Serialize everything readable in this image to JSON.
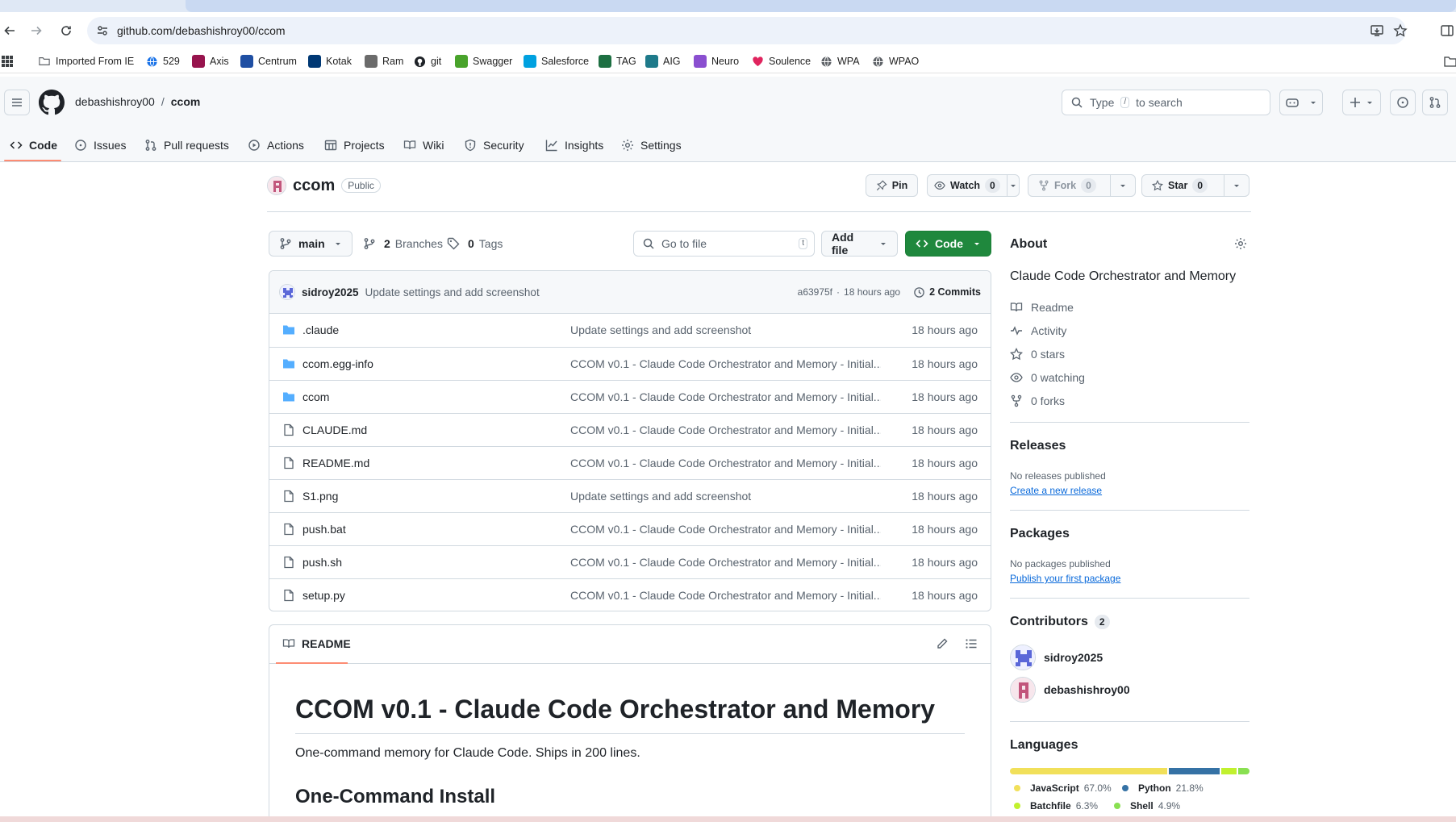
{
  "browser": {
    "url": "github.com/debashishroy00/ccom",
    "bookmarks": [
      {
        "label": "Imported From IE",
        "icon": "folder-icon",
        "color": "#5f6368"
      },
      {
        "label": "529",
        "icon": "globe-icon",
        "color": "#1a73e8"
      },
      {
        "label": "Axis",
        "icon": "axis-icon",
        "color": "#97144d"
      },
      {
        "label": "Centrum",
        "icon": "centrum-icon",
        "color": "#1f4fa3"
      },
      {
        "label": "Kotak",
        "icon": "kotak-icon",
        "color": "#003874"
      },
      {
        "label": "Ram",
        "icon": "ram-icon",
        "color": "#6b6b6b"
      },
      {
        "label": "git",
        "icon": "github-icon",
        "color": "#1f2328"
      },
      {
        "label": "Swagger",
        "icon": "swagger-icon",
        "color": "#49a32b"
      },
      {
        "label": "Salesforce",
        "icon": "salesforce-icon",
        "color": "#00a1e0"
      },
      {
        "label": "TAG",
        "icon": "excel-icon",
        "color": "#1d6f42"
      },
      {
        "label": "AIG",
        "icon": "aig-icon",
        "color": "#1e7a8a"
      },
      {
        "label": "Neuro",
        "icon": "neuro-icon",
        "color": "#8a4fd0"
      },
      {
        "label": "Soulence",
        "icon": "heart-icon",
        "color": "#e0245e"
      },
      {
        "label": "WPA",
        "icon": "globe-icon",
        "color": "#5f6368"
      },
      {
        "label": "WPAO",
        "icon": "globe-icon",
        "color": "#5f6368"
      }
    ]
  },
  "header": {
    "owner": "debashishroy00",
    "separator": "/",
    "repo": "ccom",
    "search_prefix": "Type",
    "search_key": "/",
    "search_suffix": "to search"
  },
  "repo_nav": [
    {
      "label": "Code",
      "icon": "code-icon",
      "active": true
    },
    {
      "label": "Issues",
      "icon": "issue-icon"
    },
    {
      "label": "Pull requests",
      "icon": "pull-request-icon"
    },
    {
      "label": "Actions",
      "icon": "play-icon"
    },
    {
      "label": "Projects",
      "icon": "table-icon"
    },
    {
      "label": "Wiki",
      "icon": "book-icon"
    },
    {
      "label": "Security",
      "icon": "shield-icon"
    },
    {
      "label": "Insights",
      "icon": "graph-icon"
    },
    {
      "label": "Settings",
      "icon": "gear-icon"
    }
  ],
  "repo": {
    "name": "ccom",
    "visibility": "Public",
    "pin": "Pin",
    "watch": "Watch",
    "watch_count": "0",
    "fork": "Fork",
    "fork_count": "0",
    "star": "Star",
    "star_count": "0"
  },
  "file_nav": {
    "branch": "main",
    "branches_count": "2",
    "branches_label": "Branches",
    "tags_count": "0",
    "tags_label": "Tags",
    "go_to_file": "Go to file",
    "go_to_file_key": "t",
    "add_file": "Add file",
    "code": "Code"
  },
  "latest_commit": {
    "author": "sidroy2025",
    "message": "Update settings and add screenshot",
    "sha": "a63975f",
    "separator": "·",
    "age": "18 hours ago",
    "commits_label": "2 Commits"
  },
  "files": [
    {
      "name": ".claude",
      "type": "dir",
      "message": "Update settings and add screenshot",
      "age": "18 hours ago"
    },
    {
      "name": "ccom.egg-info",
      "type": "dir",
      "message": "CCOM v0.1 - Claude Code Orchestrator and Memory - Initial...",
      "age": "18 hours ago"
    },
    {
      "name": "ccom",
      "type": "dir",
      "message": "CCOM v0.1 - Claude Code Orchestrator and Memory - Initial...",
      "age": "18 hours ago"
    },
    {
      "name": "CLAUDE.md",
      "type": "file",
      "message": "CCOM v0.1 - Claude Code Orchestrator and Memory - Initial...",
      "age": "18 hours ago"
    },
    {
      "name": "README.md",
      "type": "file",
      "message": "CCOM v0.1 - Claude Code Orchestrator and Memory - Initial...",
      "age": "18 hours ago"
    },
    {
      "name": "S1.png",
      "type": "file",
      "message": "Update settings and add screenshot",
      "age": "18 hours ago"
    },
    {
      "name": "push.bat",
      "type": "file",
      "message": "CCOM v0.1 - Claude Code Orchestrator and Memory - Initial...",
      "age": "18 hours ago"
    },
    {
      "name": "push.sh",
      "type": "file",
      "message": "CCOM v0.1 - Claude Code Orchestrator and Memory - Initial...",
      "age": "18 hours ago"
    },
    {
      "name": "setup.py",
      "type": "file",
      "message": "CCOM v0.1 - Claude Code Orchestrator and Memory - Initial...",
      "age": "18 hours ago"
    }
  ],
  "readme": {
    "tab": "README",
    "h1": "CCOM v0.1 - Claude Code Orchestrator and Memory",
    "p": "One-command memory for Claude Code. Ships in 200 lines.",
    "h2": "One-Command Install"
  },
  "sidebar": {
    "about": {
      "title": "About",
      "description": "Claude Code Orchestrator and Memory",
      "links": [
        {
          "label": "Readme",
          "icon": "book-icon"
        },
        {
          "label": "Activity",
          "icon": "pulse-icon"
        },
        {
          "label": "0 stars",
          "icon": "star-icon"
        },
        {
          "label": "0 watching",
          "icon": "eye-icon"
        },
        {
          "label": "0 forks",
          "icon": "fork-icon"
        }
      ]
    },
    "releases": {
      "title": "Releases",
      "empty": "No releases published",
      "link": "Create a new release"
    },
    "packages": {
      "title": "Packages",
      "empty": "No packages published",
      "link": "Publish your first package"
    },
    "contributors": {
      "title": "Contributors",
      "count": "2",
      "people": [
        {
          "login": "sidroy2025",
          "color": "#5a67d8"
        },
        {
          "login": "debashishroy00",
          "color": "#c2567c"
        }
      ]
    },
    "languages": {
      "title": "Languages",
      "items": [
        {
          "name": "JavaScript",
          "pct": "67.0%",
          "value": 67.0,
          "color": "#f1e05a"
        },
        {
          "name": "Python",
          "pct": "21.8%",
          "value": 21.8,
          "color": "#3572A5"
        },
        {
          "name": "Batchfile",
          "pct": "6.3%",
          "value": 6.3,
          "color": "#C1F12E"
        },
        {
          "name": "Shell",
          "pct": "4.9%",
          "value": 4.9,
          "color": "#89e051"
        }
      ]
    }
  }
}
